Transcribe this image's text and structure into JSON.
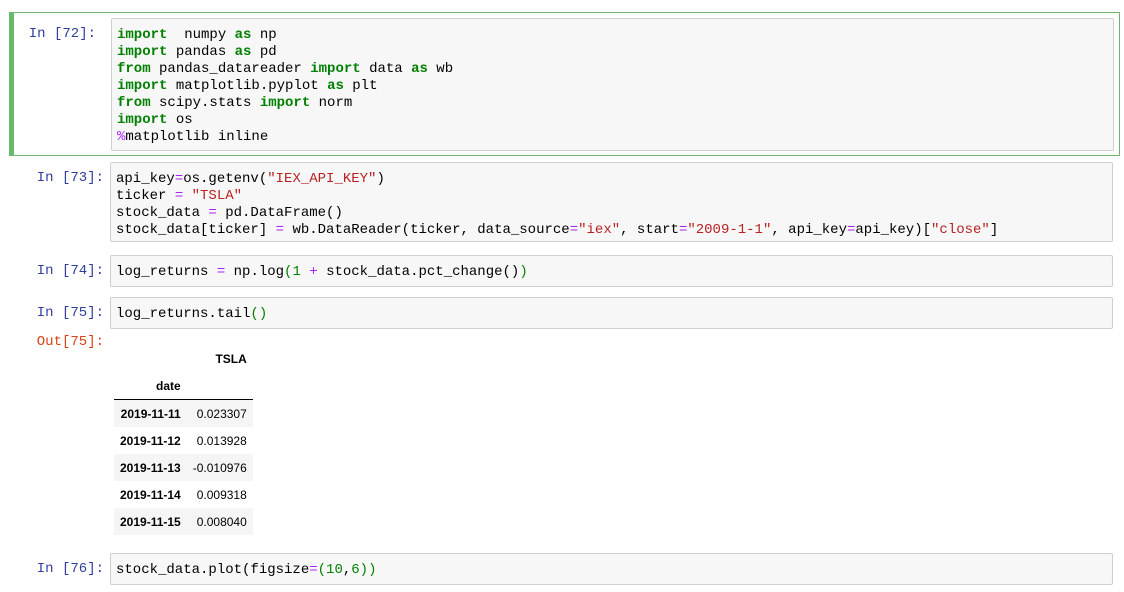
{
  "cells": {
    "c72": {
      "prompt": "In [72]:",
      "lines": [
        [
          [
            "kw",
            "import"
          ],
          [
            "",
            "  numpy "
          ],
          [
            "kw",
            "as"
          ],
          [
            "",
            " np"
          ]
        ],
        [
          [
            "kw",
            "import"
          ],
          [
            "",
            " pandas "
          ],
          [
            "kw",
            "as"
          ],
          [
            "",
            " pd"
          ]
        ],
        [
          [
            "kw",
            "from"
          ],
          [
            "",
            " pandas_datareader "
          ],
          [
            "kw",
            "import"
          ],
          [
            "",
            " data "
          ],
          [
            "kw",
            "as"
          ],
          [
            "",
            " wb"
          ]
        ],
        [
          [
            "kw",
            "import"
          ],
          [
            "",
            " matplotlib.pyplot "
          ],
          [
            "kw",
            "as"
          ],
          [
            "",
            " plt"
          ]
        ],
        [
          [
            "kw",
            "from"
          ],
          [
            "",
            " scipy.stats "
          ],
          [
            "kw",
            "import"
          ],
          [
            "",
            " norm"
          ]
        ],
        [
          [
            "kw",
            "import"
          ],
          [
            "",
            " os"
          ]
        ],
        [
          [
            "magic",
            "%"
          ],
          [
            "",
            "matplotlib inline"
          ]
        ]
      ]
    },
    "c73": {
      "prompt": "In [73]:",
      "lines": [
        [
          [
            "",
            "api_key"
          ],
          [
            "op",
            "="
          ],
          [
            "",
            "os.getenv("
          ],
          [
            "str",
            "\"IEX_API_KEY\""
          ],
          [
            "",
            ")"
          ]
        ],
        [
          [
            "",
            "ticker "
          ],
          [
            "op",
            "="
          ],
          [
            "",
            " "
          ],
          [
            "str",
            "\"TSLA\""
          ]
        ],
        [
          [
            "",
            "stock_data "
          ],
          [
            "op",
            "="
          ],
          [
            "",
            " pd.DataFrame()"
          ]
        ],
        [
          [
            "",
            "stock_data[ticker] "
          ],
          [
            "op",
            "="
          ],
          [
            "",
            " wb.DataReader(ticker, data_source"
          ],
          [
            "op",
            "="
          ],
          [
            "str",
            "\"iex\""
          ],
          [
            "",
            ", start"
          ],
          [
            "op",
            "="
          ],
          [
            "str",
            "\"2009-1-1\""
          ],
          [
            "",
            ", api_key"
          ],
          [
            "op",
            "="
          ],
          [
            "",
            "api_key)["
          ],
          [
            "str",
            "\"close\""
          ],
          [
            "",
            "]"
          ]
        ]
      ]
    },
    "c74": {
      "prompt": "In [74]:",
      "lines": [
        [
          [
            "",
            "log_returns "
          ],
          [
            "op",
            "="
          ],
          [
            "",
            " np.log"
          ],
          [
            "par",
            "("
          ],
          [
            "num",
            "1"
          ],
          [
            "",
            " "
          ],
          [
            "op",
            "+"
          ],
          [
            "",
            " stock_data.pct_change()"
          ],
          [
            "par",
            ")"
          ]
        ]
      ]
    },
    "c75": {
      "prompt": "In [75]:",
      "out_prompt": "Out[75]:",
      "lines": [
        [
          [
            "",
            "log_returns.tail"
          ],
          [
            "par",
            "()"
          ]
        ]
      ],
      "table": {
        "column": "TSLA",
        "index_name": "date",
        "rows": [
          {
            "date": "2019-11-11",
            "value": "0.023307"
          },
          {
            "date": "2019-11-12",
            "value": "0.013928"
          },
          {
            "date": "2019-11-13",
            "value": "-0.010976"
          },
          {
            "date": "2019-11-14",
            "value": "0.009318"
          },
          {
            "date": "2019-11-15",
            "value": "0.008040"
          }
        ]
      }
    },
    "c76": {
      "prompt": "In [76]:",
      "lines": [
        [
          [
            "",
            "stock_data.plot(figsize"
          ],
          [
            "op",
            "="
          ],
          [
            "par",
            "("
          ],
          [
            "num",
            "10"
          ],
          [
            "",
            ","
          ],
          [
            "num",
            "6"
          ],
          [
            "par",
            "))"
          ]
        ]
      ]
    }
  },
  "colors": {
    "prompt_in": "#303f9f",
    "prompt_out": "#d84315",
    "selected_border": "#66bb6a",
    "keyword": "#008000",
    "string": "#ba2121",
    "operator": "#aa22ff"
  }
}
